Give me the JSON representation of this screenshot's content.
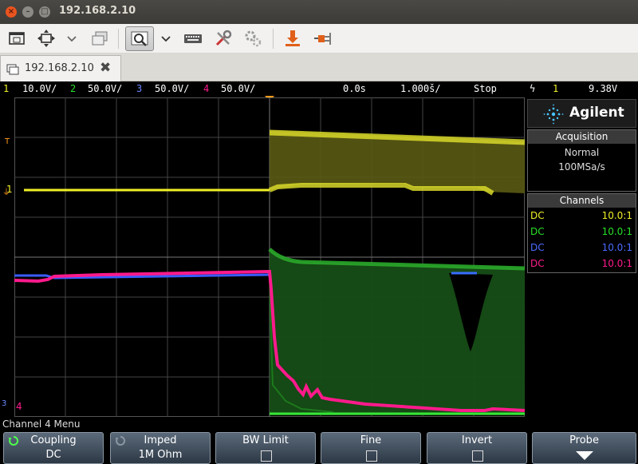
{
  "window": {
    "title": "192.168.2.10"
  },
  "toolbar": {
    "icons": [
      "window-icon",
      "move-icon",
      "chevron-down-icon",
      "windows-icon",
      "zoom-icon",
      "chevron-down-icon",
      "keyboard-icon",
      "tools-icon",
      "settings-icon",
      "transfer-icon",
      "plug-icon"
    ]
  },
  "tab": {
    "label": "192.168.2.10"
  },
  "status": {
    "ch1_num": "1",
    "ch1_scale": "10.0V/",
    "ch2_num": "2",
    "ch2_scale": "50.0V/",
    "ch3_num": "3",
    "ch3_scale": "50.0V/",
    "ch4_num": "4",
    "ch4_scale": "50.0V/",
    "delay": "0.0s",
    "timebase": "1.000š/",
    "run_state": "Stop",
    "trig_source": "1",
    "trig_level": "9.38V"
  },
  "grid_markers": {
    "trigger_t": "T",
    "ch1_marker": "1",
    "ch3_marker": "3",
    "ch4_marker": "4"
  },
  "panel": {
    "brand": "Agilent",
    "acquisition": {
      "title": "Acquisition",
      "mode": "Normal",
      "rate": "100MSa/s"
    },
    "channels": {
      "title": "Channels",
      "rows": [
        {
          "coupling": "DC",
          "probe": "10.0:1",
          "color": "#f0f028"
        },
        {
          "coupling": "DC",
          "probe": "10.0:1",
          "color": "#28e028"
        },
        {
          "coupling": "DC",
          "probe": "10.0:1",
          "color": "#4a6cff"
        },
        {
          "coupling": "DC",
          "probe": "10.0:1",
          "color": "#ff1a8c"
        }
      ]
    }
  },
  "menu": {
    "title": "Channel 4 Menu",
    "softkeys": [
      {
        "label": "Coupling",
        "value": "DC"
      },
      {
        "label": "Imped",
        "value": "1M Ohm"
      },
      {
        "label": "BW Limit"
      },
      {
        "label": "Fine"
      },
      {
        "label": "Invert"
      },
      {
        "label": "Probe"
      }
    ]
  },
  "colors": {
    "ch1": "#f0f028",
    "ch2": "#28e028",
    "ch3": "#4a6cff",
    "ch4": "#ff1a8c",
    "trigger": "#ff9a1a"
  }
}
